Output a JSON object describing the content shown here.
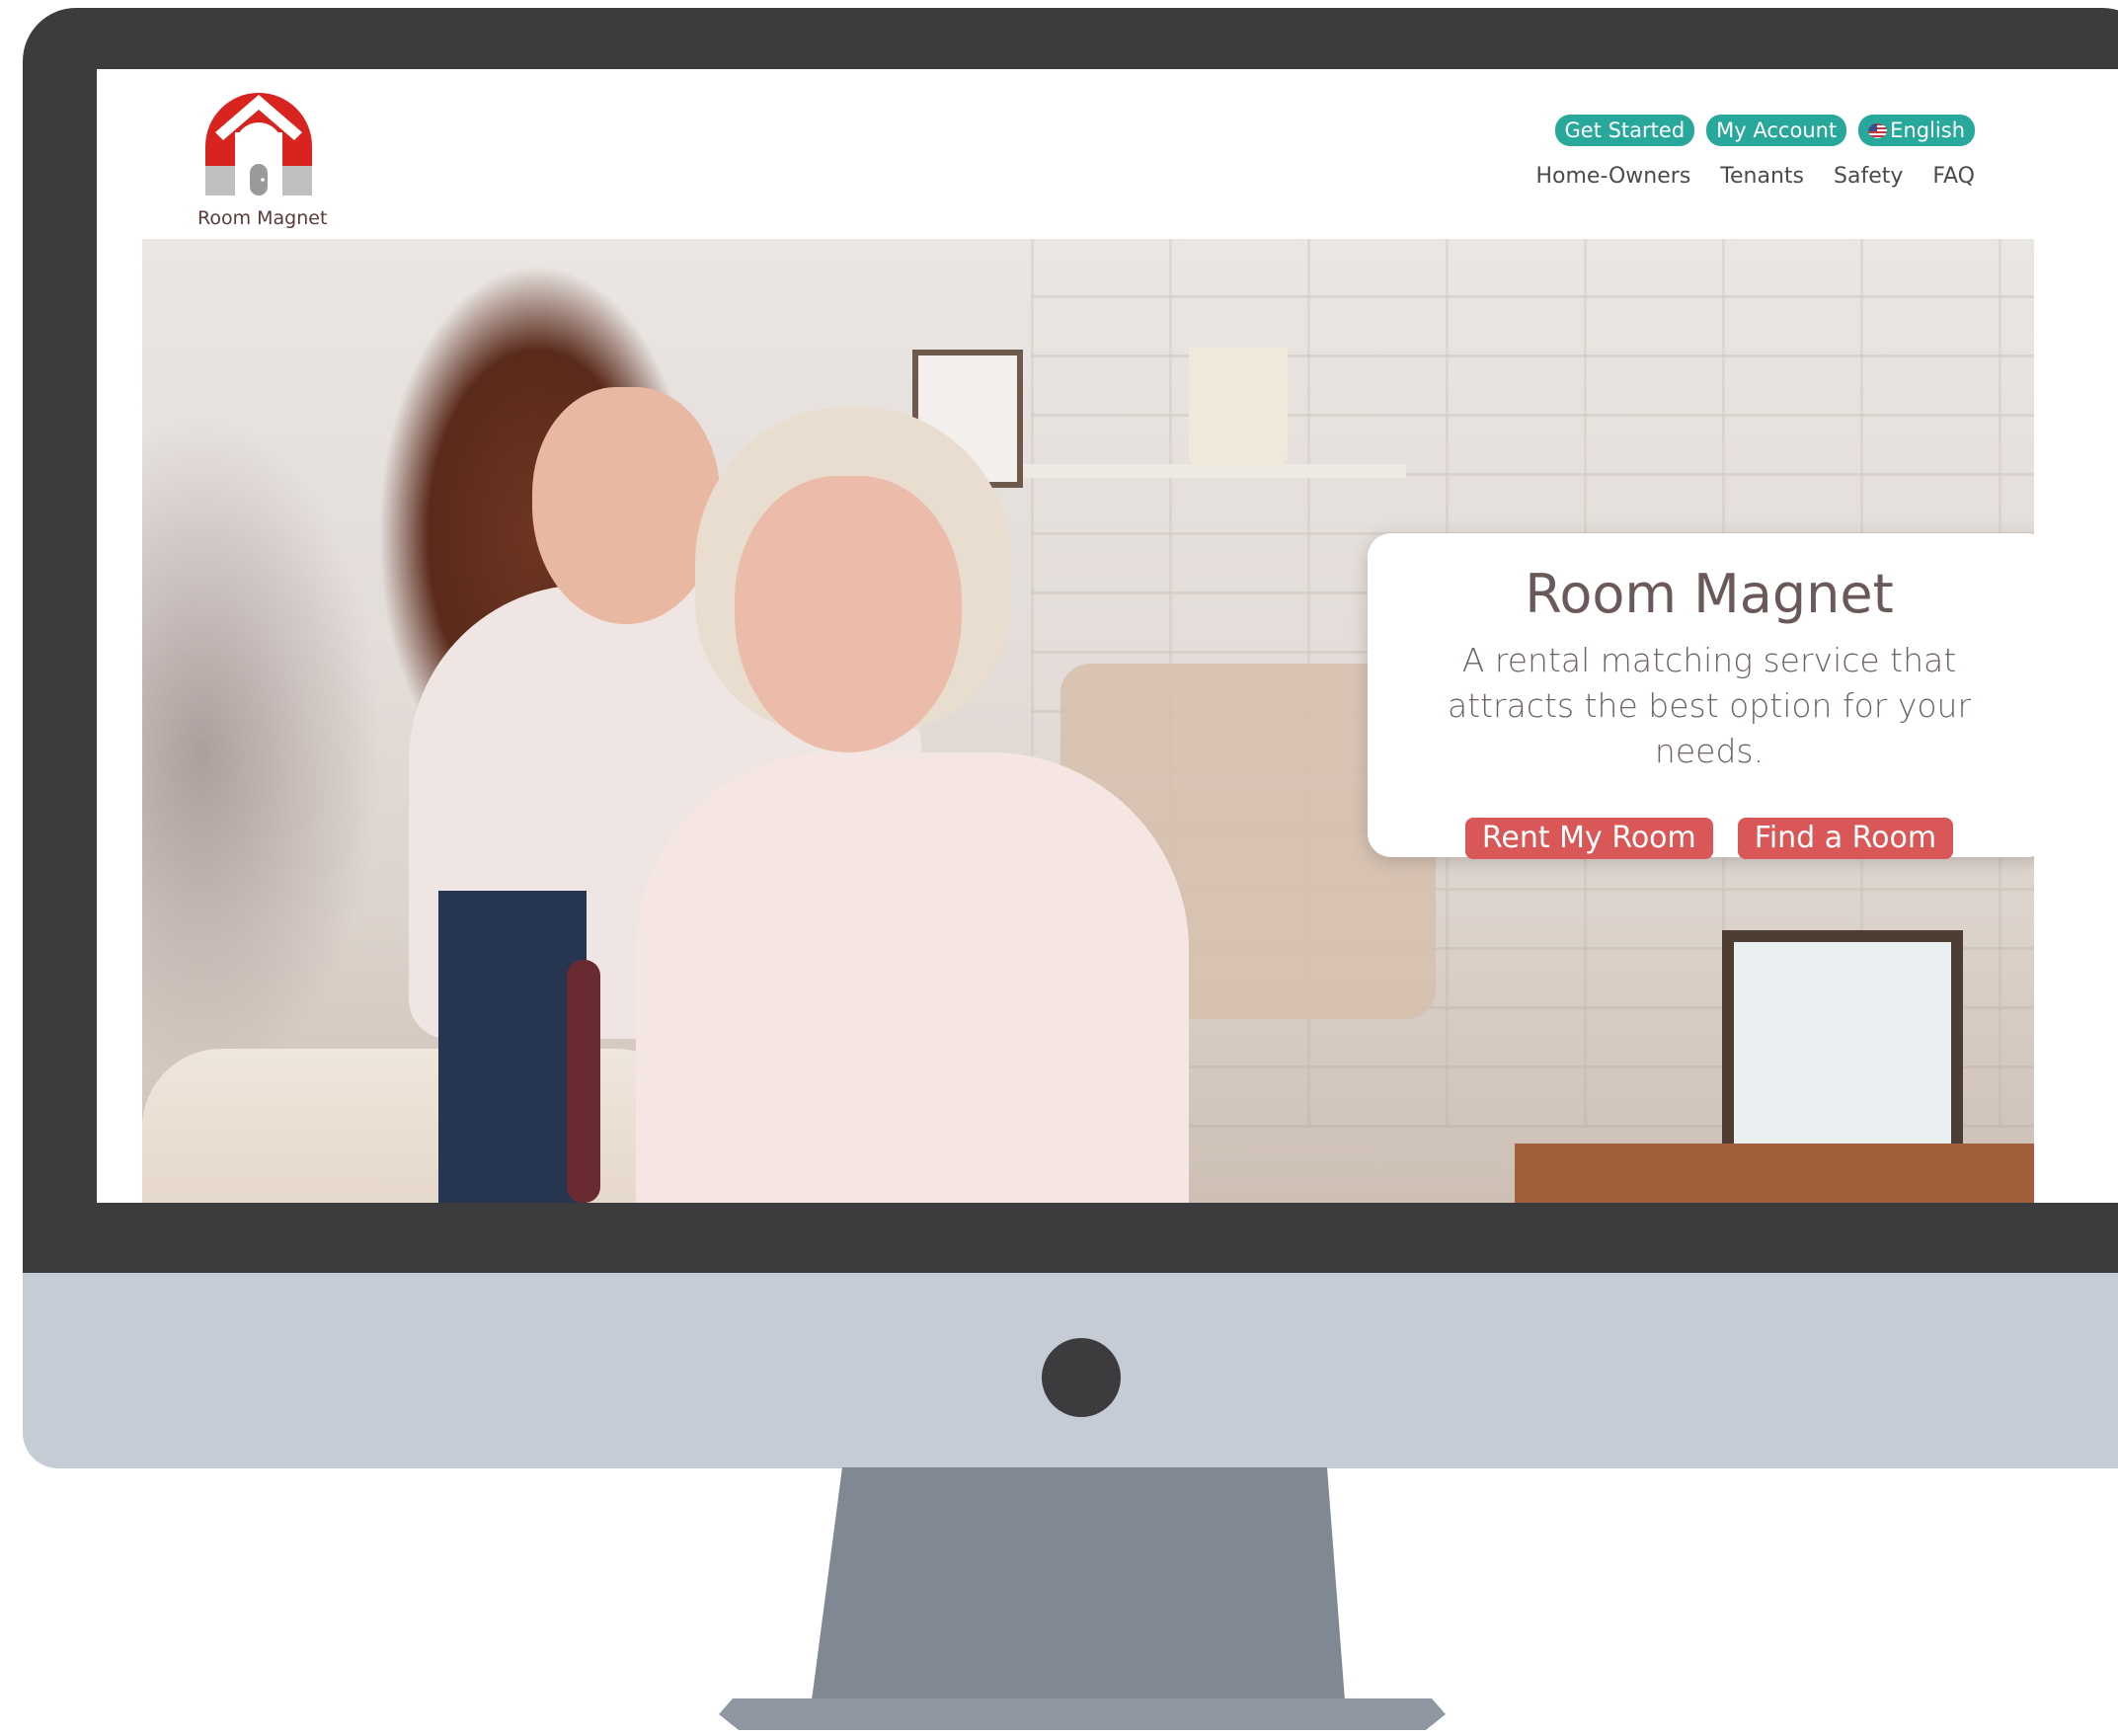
{
  "brand": {
    "name": "Room Magnet",
    "logo_colors": {
      "magnet_red": "#d8231f",
      "house_gray": "#9a9a9a",
      "tip_gray": "#bfbfbf"
    }
  },
  "header": {
    "actions": [
      {
        "label": "Get Started"
      },
      {
        "label": "My Account"
      },
      {
        "label": "English",
        "icon": "us-flag-icon"
      }
    ],
    "nav": [
      "Home-Owners",
      "Tenants",
      "Safety",
      "FAQ"
    ]
  },
  "hero": {
    "title": "Room Magnet",
    "subtitle": "A rental matching service that attracts the best option for your needs.",
    "buttons": [
      "Rent My Room",
      "Find a Room"
    ]
  },
  "colors": {
    "pill_teal": "#27a89b",
    "cta_red": "#d95757",
    "monitor_bezel": "#3c3c3e",
    "monitor_chin": "#c6ccd6",
    "monitor_stand": "#7f8893"
  }
}
